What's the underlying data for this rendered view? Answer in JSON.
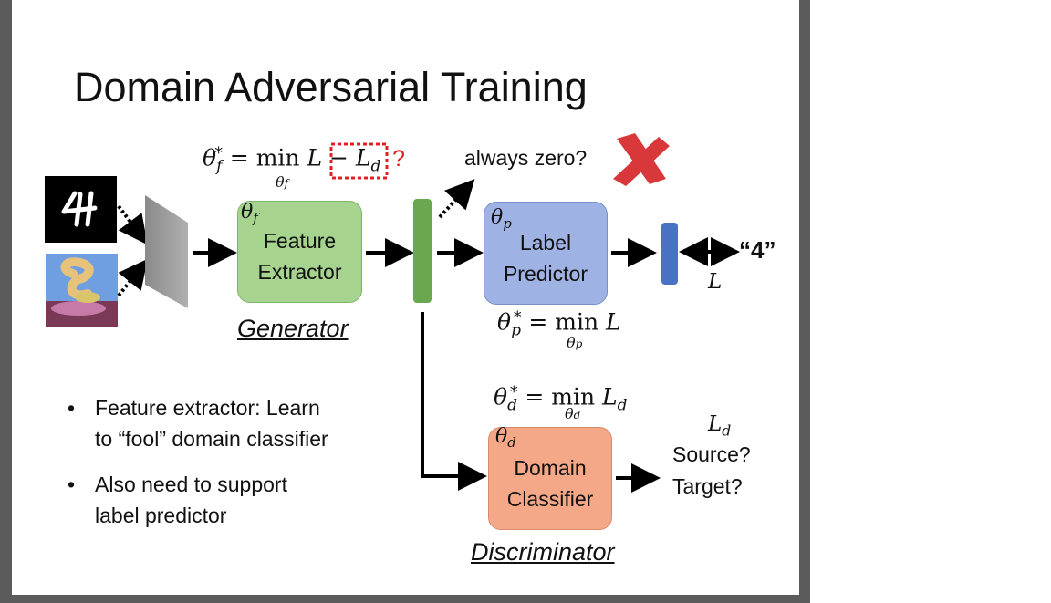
{
  "slide": {
    "title": "Domain Adversarial Training",
    "generator_caption": "Generator",
    "discriminator_caption": "Discriminator",
    "question_mark": "?",
    "always_zero": "always zero?",
    "output_label": "“4”",
    "loss_symbol": "L",
    "domain_loss_symbol": "L_d",
    "domain_outputs": [
      "Source?",
      "Target?"
    ]
  },
  "boxes": {
    "feature_extractor": {
      "label_line1": "Feature",
      "label_line2": "Extractor",
      "param": "θ_f",
      "color": "#a6d48f"
    },
    "label_predictor": {
      "label_line1": "Label",
      "label_line2": "Predictor",
      "param": "θ_p",
      "color": "#9fb2e4"
    },
    "domain_classifier": {
      "label_line1": "Domain",
      "label_line2": "Classifier",
      "param": "θ_d",
      "color": "#f4a888"
    }
  },
  "equations": {
    "feature": "θ_f* = min_{θ_f} L − L_d",
    "label": "θ_p* = min_{θ_p} L",
    "domain": "θ_d* = min_{θ_d} L_d"
  },
  "bullets": [
    {
      "line1": "Feature extractor: Learn",
      "line2": "to “fool” domain classifier"
    },
    {
      "line1": "Also need to support",
      "line2": "label predictor"
    }
  ],
  "colors": {
    "feature_bar": "#6aa84f",
    "output_bar": "#4a72c4",
    "highlight": "#e02020",
    "cross": "#d9383a"
  }
}
